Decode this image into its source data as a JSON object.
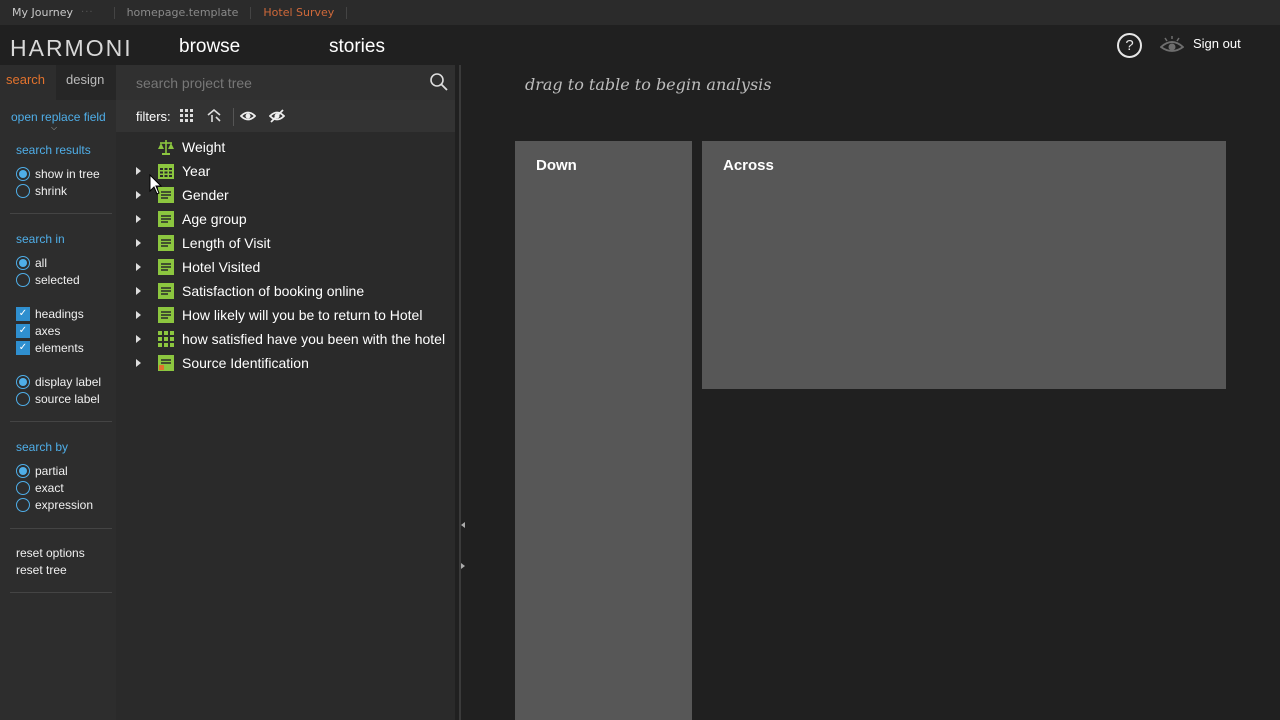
{
  "breadcrumb": {
    "items": [
      "My Journey",
      "homepage.template",
      "Hotel Survey"
    ],
    "dots": "···"
  },
  "header": {
    "logo": "HARMONI",
    "nav": [
      "browse",
      "stories"
    ],
    "help": "?",
    "signout": "Sign out"
  },
  "left_panel": {
    "tabs": [
      "search",
      "design"
    ],
    "open_replace": "open replace field",
    "search_results": {
      "title": "search results",
      "options": [
        {
          "label": "show in tree",
          "selected": true
        },
        {
          "label": "shrink",
          "selected": false
        }
      ]
    },
    "search_in": {
      "title": "search in",
      "scope": [
        {
          "label": "all",
          "selected": true
        },
        {
          "label": "selected",
          "selected": false
        }
      ],
      "types": [
        {
          "label": "headings",
          "checked": true
        },
        {
          "label": "axes",
          "checked": true
        },
        {
          "label": "elements",
          "checked": true
        }
      ],
      "labels": [
        {
          "label": "display label",
          "selected": true
        },
        {
          "label": "source label",
          "selected": false
        }
      ]
    },
    "search_by": {
      "title": "search by",
      "options": [
        {
          "label": "partial",
          "selected": true
        },
        {
          "label": "exact",
          "selected": false
        },
        {
          "label": "expression",
          "selected": false
        }
      ]
    },
    "reset_options": "reset options",
    "reset_tree": "reset tree"
  },
  "tree_panel": {
    "search_placeholder": "search project tree",
    "filters_label": "filters:",
    "nodes": [
      {
        "label": "Weight",
        "icon": "weight-icon",
        "expandable": false
      },
      {
        "label": "Year",
        "icon": "calendar-icon",
        "expandable": true
      },
      {
        "label": "Gender",
        "icon": "single-variable-icon",
        "expandable": true
      },
      {
        "label": "Age group",
        "icon": "single-variable-icon",
        "expandable": true
      },
      {
        "label": "Length of Visit",
        "icon": "single-variable-icon",
        "expandable": true
      },
      {
        "label": "Hotel Visited",
        "icon": "single-variable-icon",
        "expandable": true
      },
      {
        "label": "Satisfaction of booking online",
        "icon": "single-variable-icon",
        "expandable": true
      },
      {
        "label": "How likely will you be to return to Hotel",
        "icon": "single-variable-icon",
        "expandable": true
      },
      {
        "label": "how satisfied have you been with the hotel",
        "icon": "grid-variable-icon",
        "expandable": true
      },
      {
        "label": "Source Identification",
        "icon": "source-variable-icon",
        "expandable": true
      }
    ]
  },
  "main": {
    "hint": "drag to table to begin analysis",
    "down_label": "Down",
    "across_label": "Across"
  },
  "colors": {
    "accent_orange": "#e2722d",
    "accent_blue": "#4faee8",
    "variable_green": "#8cc63f",
    "drop_zone": "#575757"
  }
}
